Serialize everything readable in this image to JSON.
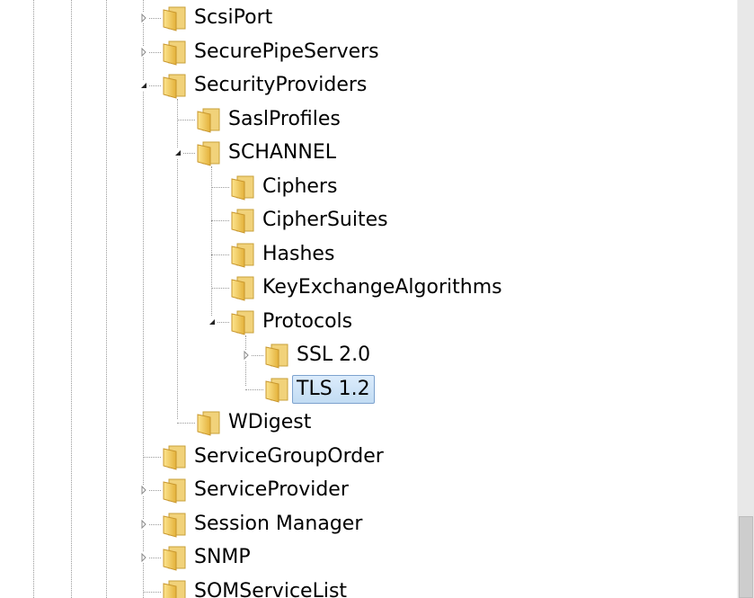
{
  "tree": {
    "items": [
      {
        "label": "ScsiPort",
        "expander": "collapsed",
        "selected": false
      },
      {
        "label": "SecurePipeServers",
        "expander": "collapsed",
        "selected": false
      },
      {
        "label": "SecurityProviders",
        "expander": "expanded",
        "selected": false
      },
      {
        "label": "SaslProfiles",
        "expander": "none",
        "selected": false
      },
      {
        "label": "SCHANNEL",
        "expander": "expanded",
        "selected": false
      },
      {
        "label": "Ciphers",
        "expander": "none",
        "selected": false
      },
      {
        "label": "CipherSuites",
        "expander": "none",
        "selected": false
      },
      {
        "label": "Hashes",
        "expander": "none",
        "selected": false
      },
      {
        "label": "KeyExchangeAlgorithms",
        "expander": "none",
        "selected": false
      },
      {
        "label": "Protocols",
        "expander": "expanded",
        "selected": false
      },
      {
        "label": "SSL 2.0",
        "expander": "collapsed",
        "selected": false
      },
      {
        "label": "TLS 1.2",
        "expander": "none",
        "selected": true
      },
      {
        "label": "WDigest",
        "expander": "none",
        "selected": false
      },
      {
        "label": "ServiceGroupOrder",
        "expander": "none",
        "selected": false
      },
      {
        "label": "ServiceProvider",
        "expander": "collapsed",
        "selected": false
      },
      {
        "label": "Session Manager",
        "expander": "collapsed",
        "selected": false
      },
      {
        "label": "SNMP",
        "expander": "collapsed",
        "selected": false
      },
      {
        "label": "SOMServiceList",
        "expander": "none",
        "selected": false
      }
    ]
  },
  "icons": {
    "folder": "folder-icon",
    "collapsed": "expand-arrow-icon",
    "expanded": "collapse-arrow-icon"
  },
  "colors": {
    "selection_fill": "#cfe3f7",
    "selection_border": "#7da2ce",
    "folder_light": "#fde58f",
    "folder_dark": "#e3b13a"
  }
}
